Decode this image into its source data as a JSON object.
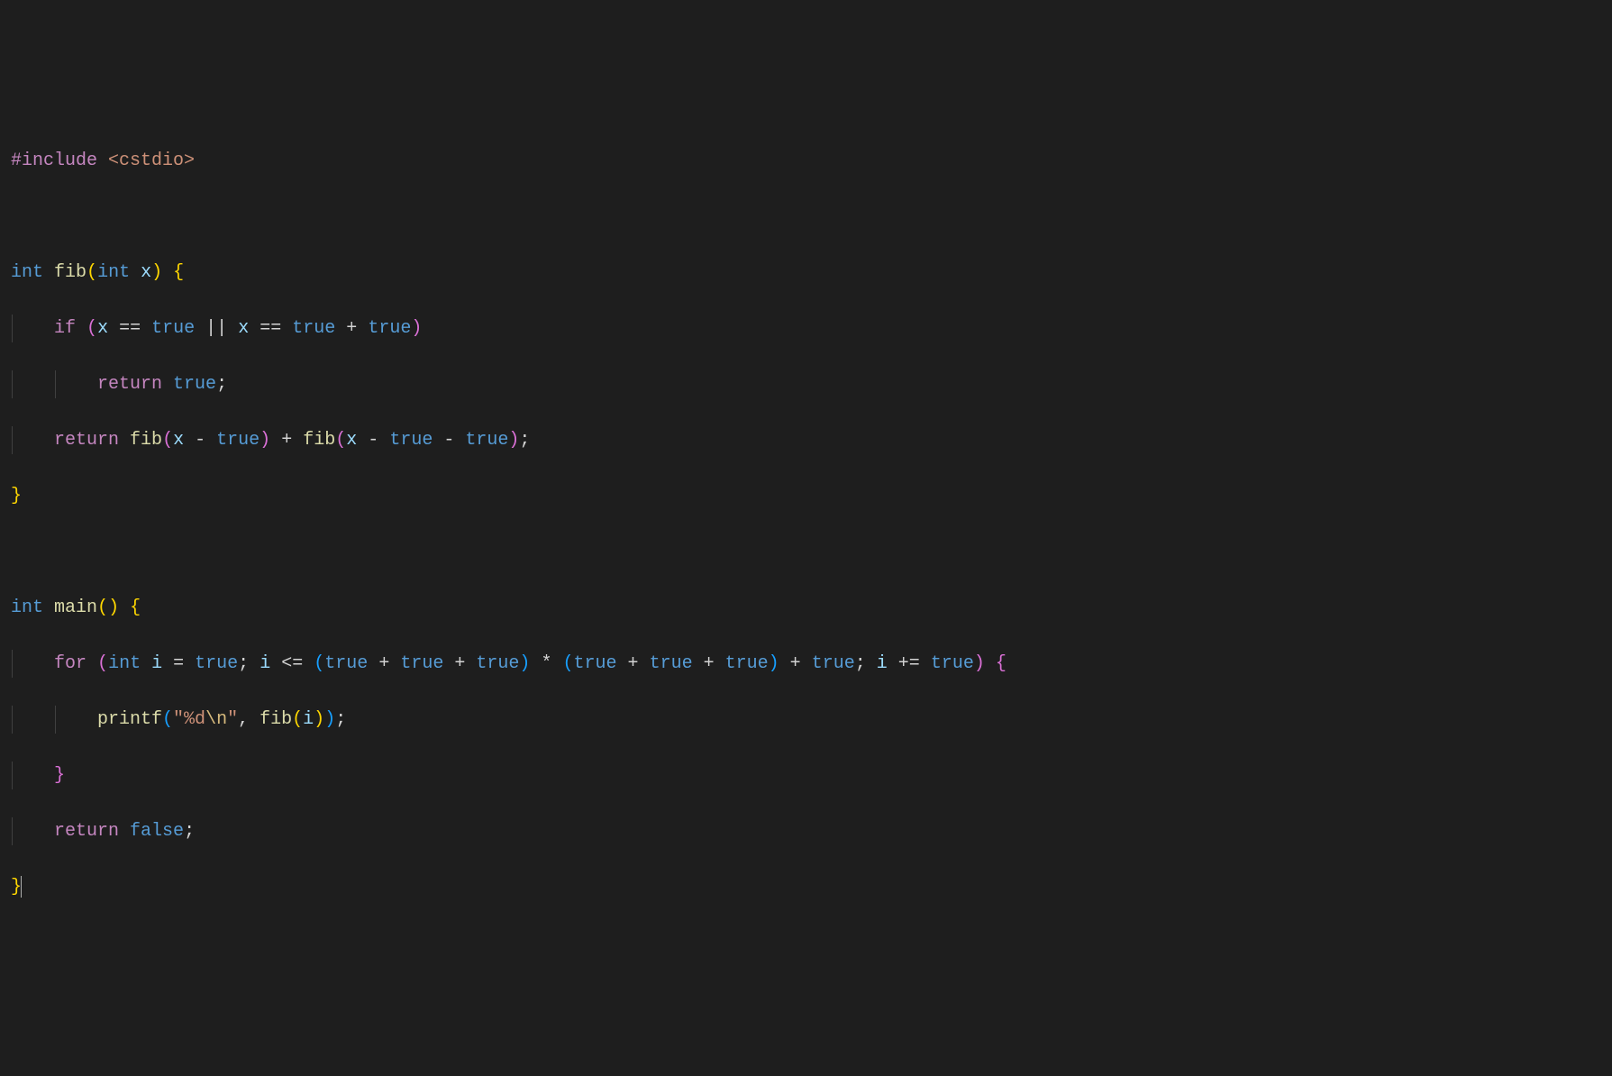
{
  "code": {
    "line1": {
      "include": "#include",
      "path": "<cstdio>"
    },
    "line3": {
      "type1": "int",
      "func": "fib",
      "paren_open": "(",
      "type2": "int",
      "param": "x",
      "paren_close": ")",
      "brace": "{"
    },
    "line4": {
      "indent": "    ",
      "if": "if",
      "po": "(",
      "x1": "x",
      "eq1": "==",
      "true1": "true",
      "or": "||",
      "x2": "x",
      "eq2": "==",
      "true2": "true",
      "plus": "+",
      "true3": "true",
      "pc": ")"
    },
    "line5": {
      "indent": "        ",
      "return": "return",
      "true": "true",
      "semi": ";"
    },
    "line6": {
      "indent": "    ",
      "return": "return",
      "fib1": "fib",
      "po1": "(",
      "x1": "x",
      "minus1": "-",
      "true1": "true",
      "pc1": ")",
      "plus": "+",
      "fib2": "fib",
      "po2": "(",
      "x2": "x",
      "minus2": "-",
      "true2": "true",
      "minus3": "-",
      "true3": "true",
      "pc2": ")",
      "semi": ";"
    },
    "line7": {
      "brace": "}"
    },
    "line9": {
      "type": "int",
      "func": "main",
      "po": "(",
      "pc": ")",
      "brace": "{"
    },
    "line10": {
      "indent": "    ",
      "for": "for",
      "po": "(",
      "type": "int",
      "i1": "i",
      "assign": "=",
      "true1": "true",
      "semi1": ";",
      "i2": "i",
      "lte": "<=",
      "po2": "(",
      "true2": "true",
      "plus1": "+",
      "true3": "true",
      "plus2": "+",
      "true4": "true",
      "pc2": ")",
      "mult": "*",
      "po3": "(",
      "true5": "true",
      "plus3": "+",
      "true6": "true",
      "plus4": "+",
      "true7": "true",
      "pc3": ")",
      "plus5": "+",
      "true8": "true",
      "semi2": ";",
      "i3": "i",
      "pluseq": "+=",
      "true9": "true",
      "pc": ")",
      "brace": "{"
    },
    "line11": {
      "indent": "        ",
      "printf": "printf",
      "po": "(",
      "str1": "\"%d",
      "esc": "\\n",
      "str2": "\"",
      "comma": ",",
      "fib": "fib",
      "po2": "(",
      "i": "i",
      "pc2": ")",
      "pc": ")",
      "semi": ";"
    },
    "line12": {
      "indent": "    ",
      "brace": "}"
    },
    "line13": {
      "indent": "    ",
      "return": "return",
      "false": "false",
      "semi": ";"
    },
    "line14": {
      "brace": "}"
    }
  }
}
